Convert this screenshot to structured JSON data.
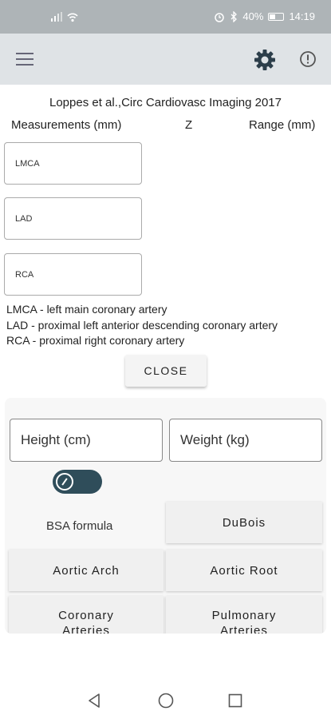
{
  "status_bar": {
    "battery": "40%",
    "time": "14:19"
  },
  "app_bar": {
    "icons": [
      "menu-icon",
      "gear-icon",
      "info-icon"
    ]
  },
  "citation": "Loppes et al.,Circ Cardiovasc Imaging 2017",
  "table_header": {
    "measurements": "Measurements (mm)",
    "z": "Z",
    "range": "Range (mm)"
  },
  "fields": {
    "lmca": "LMCA",
    "lad": "LAD",
    "rca": "RCA"
  },
  "legend": {
    "lmca": "LMCA - left main coronary artery",
    "lad": "LAD - proximal left anterior descending coronary artery",
    "rca": "RCA - proximal right coronary artery"
  },
  "close_label": "CLOSE",
  "panel": {
    "height_placeholder": "Height (cm)",
    "weight_placeholder": "Weight (kg)",
    "bsa_label": "BSA formula",
    "bsa_value": "DuBois",
    "tiles": {
      "aortic_arch": "Aortic Arch",
      "aortic_root": "Aortic Root",
      "coronary": "Coronary Arteries",
      "pulmonary": "Pulmonary Arteries"
    }
  },
  "colors": {
    "status_bar": "#aeb4b7",
    "app_bar": "#dfe3e6",
    "toggle": "#2f4d5a"
  }
}
